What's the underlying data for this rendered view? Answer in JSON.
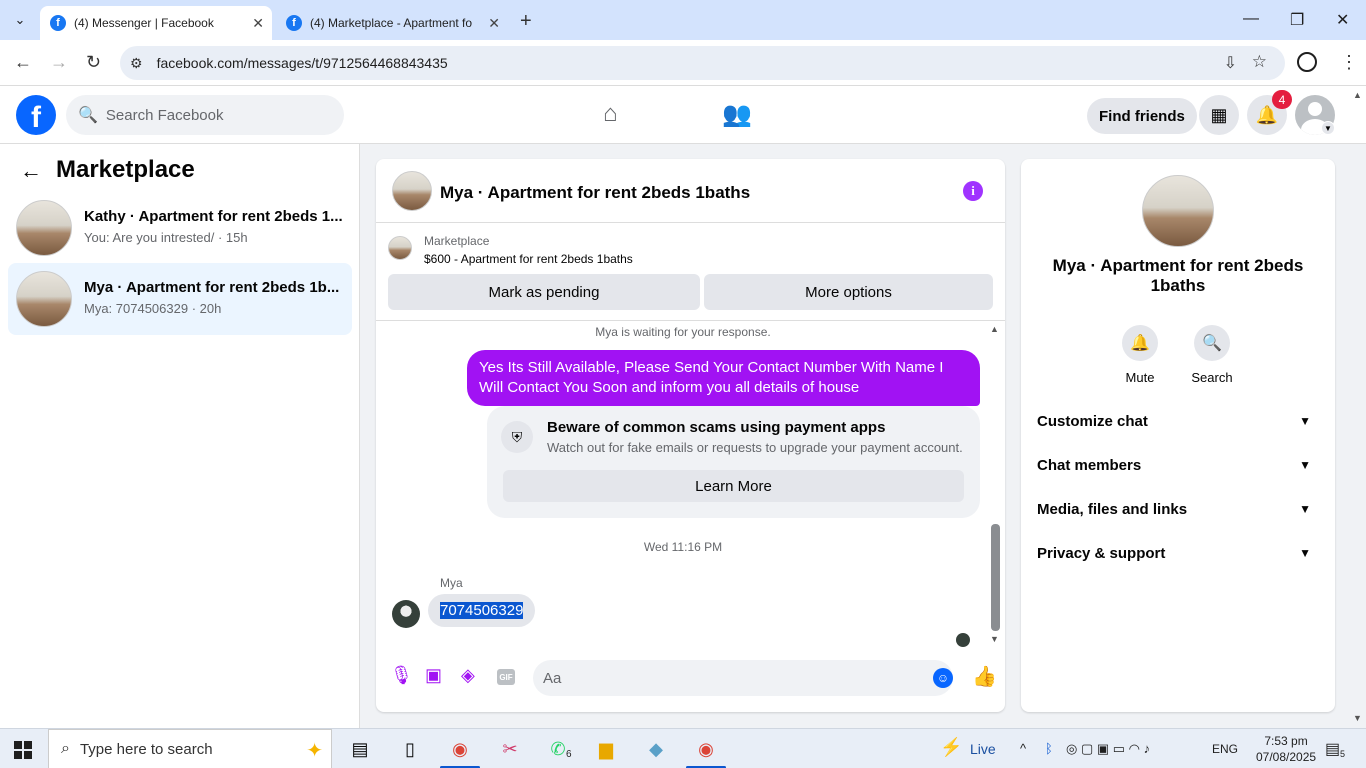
{
  "browser": {
    "tabs": [
      {
        "title": "(4) Messenger | Facebook",
        "active": true
      },
      {
        "title": "(4) Marketplace - Apartment fo",
        "active": false
      }
    ],
    "url": "facebook.com/messages/t/9712564468843435"
  },
  "fb_header": {
    "search_placeholder": "Search Facebook",
    "find_friends": "Find friends",
    "notification_count": "4",
    "brand_color": "#0866ff"
  },
  "sidebar": {
    "title": "Marketplace",
    "threads": [
      {
        "name": "Kathy · Apartment for rent 2beds 1...",
        "preview": "You: Are you intrested/ · 15h",
        "selected": false
      },
      {
        "name": "Mya · Apartment for rent 2beds 1b...",
        "preview": "Mya: 7074506329 · 20h",
        "selected": true
      }
    ]
  },
  "chat": {
    "title": "Mya · Apartment for rent 2beds 1baths",
    "listing_label": "Marketplace",
    "listing_desc": "$600 - Apartment for rent 2beds 1baths",
    "btn_pending": "Mark as pending",
    "btn_more": "More options",
    "waiting": "Mya is waiting for your response.",
    "out_message": "Yes Its Still Available, Please Send Your Contact Number With Name I Will Contact You Soon and inform you all details of house",
    "scam_title": "Beware of common scams using payment apps",
    "scam_desc": "Watch out for fake emails or requests to upgrade your payment account.",
    "learn_more": "Learn More",
    "timestamp": "Wed 11:16 PM",
    "sender": "Mya",
    "in_message": "7074506329",
    "composer_placeholder": "Aa",
    "accent_color": "#a112f3"
  },
  "details": {
    "name": "Mya · Apartment for rent 2beds 1baths",
    "actions": [
      {
        "label": "Mute",
        "icon": "bell-icon"
      },
      {
        "label": "Search",
        "icon": "search-icon"
      }
    ],
    "sections": [
      "Customize chat",
      "Chat members",
      "Media, files and links",
      "Privacy & support"
    ]
  },
  "taskbar": {
    "search_placeholder": "Type here to search",
    "live_label": "Live",
    "whatsapp_badge": "6",
    "language": "ENG",
    "time": "7:53 pm",
    "date": "07/08/2025",
    "notif_count": "5"
  }
}
